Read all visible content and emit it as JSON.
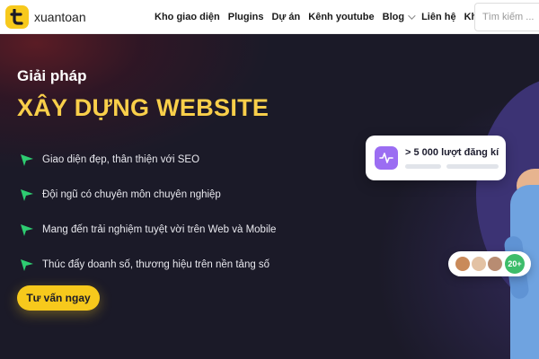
{
  "header": {
    "logo_letter": "t",
    "logo_text": "xuantoan",
    "nav": [
      {
        "label": "Kho giao diện",
        "has_dropdown": false
      },
      {
        "label": "Plugins",
        "has_dropdown": false
      },
      {
        "label": "Dự án",
        "has_dropdown": false
      },
      {
        "label": "Kênh youtube",
        "has_dropdown": false
      },
      {
        "label": "Blog",
        "has_dropdown": true
      },
      {
        "label": "Liên hệ",
        "has_dropdown": false
      },
      {
        "label": "Khác",
        "has_dropdown": true
      }
    ],
    "search_placeholder": "Tìm kiếm ..."
  },
  "hero": {
    "eyebrow": "Giải pháp",
    "headline": "XÂY DỰNG WEBSITE",
    "features": [
      "Giao diện đẹp, thân thiện với SEO",
      "Đội ngũ có chuyên môn chuyên nghiệp",
      "Mang đến trải nghiệm tuyệt vời trên Web và Mobile",
      "Thúc đẩy doanh số, thương hiệu trên nền tảng số"
    ],
    "cta_label": "Tư vấn ngay",
    "stat_text": "> 5 000 lượt đăng kí",
    "user_count": "20+"
  },
  "colors": {
    "accent_yellow": "#f7c91c",
    "headline_yellow": "#f9cf4a",
    "hero_bg": "#1b1a28",
    "feature_arrow": "#2ecc71",
    "stat_icon": "#9b6df2",
    "count_badge": "#3dbd6a"
  },
  "icons": {
    "logo": "t-logo-icon",
    "feature_bullet": "send-arrow-icon",
    "stat": "activity-pulse-icon"
  }
}
